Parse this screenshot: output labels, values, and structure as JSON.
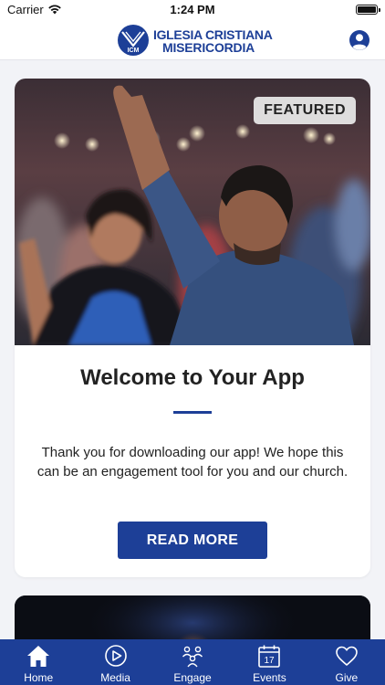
{
  "status_bar": {
    "carrier": "Carrier",
    "time": "1:24 PM",
    "wifi_icon": "wifi-icon",
    "battery_icon": "battery-full-icon"
  },
  "header": {
    "logo_line1": "IGLESIA CRISTIANA",
    "logo_line2": "MISERICORDIA",
    "logo_mark_text": "ICM",
    "profile_icon": "user-profile-icon",
    "brand_color": "#1d3f97"
  },
  "featured_card": {
    "badge": "FEATURED",
    "title": "Welcome to Your App",
    "body": "Thank you for downloading our app! We hope this can be an engagement tool for you and our church.",
    "button_label": "READ MORE",
    "image_description_icon": "worship-photo"
  },
  "tab_bar": {
    "items": [
      {
        "label": "Home",
        "icon": "home-icon",
        "active": true
      },
      {
        "label": "Media",
        "icon": "play-circle-icon",
        "active": false
      },
      {
        "label": "Engage",
        "icon": "people-group-icon",
        "active": false
      },
      {
        "label": "Events",
        "icon": "calendar-icon",
        "icon_text": "17",
        "active": false
      },
      {
        "label": "Give",
        "icon": "heart-icon",
        "active": false
      }
    ]
  }
}
